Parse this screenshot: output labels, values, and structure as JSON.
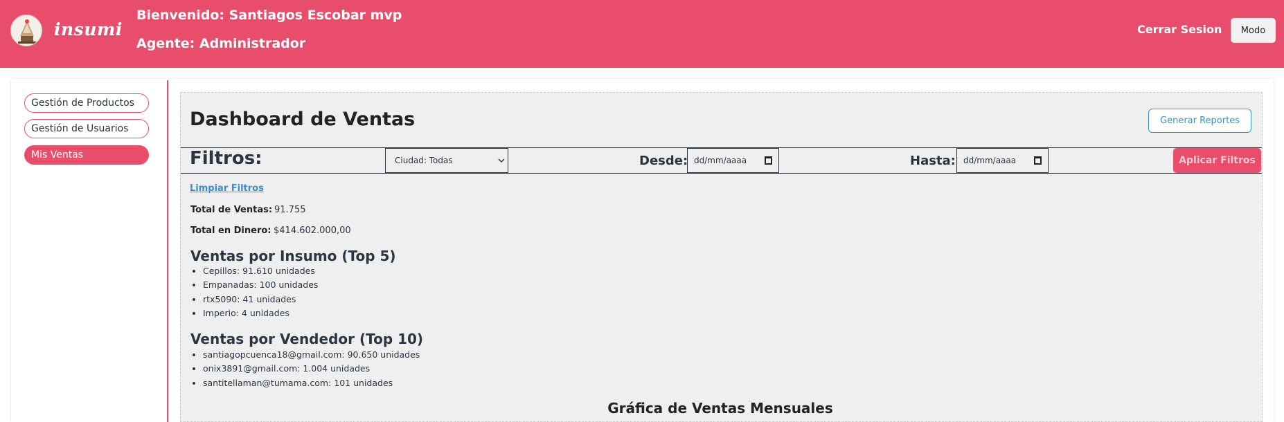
{
  "header": {
    "brand": "insumi",
    "welcome": "Bienvenido: Santiagos Escobar mvp",
    "agent": "Agente: Administrador",
    "logout_label": "Cerrar Sesion",
    "mode_label": "Modo"
  },
  "sidebar": {
    "items": [
      {
        "label": "Gestión de Productos",
        "active": false
      },
      {
        "label": "Gestión de Usuarios",
        "active": false
      },
      {
        "label": "Mis Ventas",
        "active": true
      }
    ]
  },
  "dashboard": {
    "title": "Dashboard de Ventas",
    "generate_report_label": "Generar Reportes"
  },
  "filters": {
    "title": "Filtros:",
    "city_selected": "Ciudad: Todas",
    "from_label": "Desde:",
    "to_label": "Hasta:",
    "date_placeholder": "dd/mm/aaaa",
    "apply_label": "Aplicar Filtros",
    "clear_label": "Limpiar Filtros"
  },
  "stats": {
    "total_sales_label": "Total de Ventas:",
    "total_sales_value": "91.755",
    "total_money_label": "Total en Dinero:",
    "total_money_value": "$414.602.000,00"
  },
  "by_supply": {
    "title": "Ventas por Insumo (Top 5)",
    "items": [
      "Cepillos: 91.610 unidades",
      "Empanadas: 100 unidades",
      "rtx5090: 41 unidades",
      "Imperio: 4 unidades"
    ]
  },
  "by_seller": {
    "title": "Ventas por Vendedor (Top 10)",
    "items": [
      "santiagopcuenca18@gmail.com: 90.650 unidades",
      "onix3891@gmail.com: 1.004 unidades",
      "santitellaman@tumama.com: 101 unidades"
    ]
  },
  "chart": {
    "title": "Gráfica de Ventas Mensuales"
  },
  "colors": {
    "brand": "#e84d6b",
    "link": "#3a8fd0",
    "content_bg": "#efefef"
  }
}
